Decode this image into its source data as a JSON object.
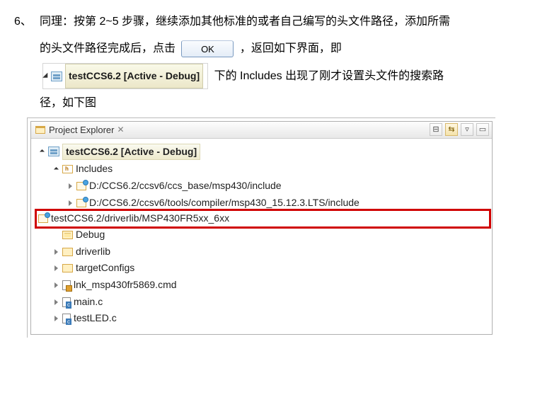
{
  "step": {
    "number": "6、",
    "line1_a": "同理：按第 2~5 步骤，继续添加其他标准的或者自己编写的头文件路径，添加所需",
    "line1_b": "的头文件路径完成后，点击",
    "ok_label": "OK",
    "line1_c": "，返回如下界面，即",
    "badge_project": "testCCS6.2  [Active - Debug]",
    "line2": "下的 Includes 出现了刚才设置头文件的搜索路",
    "line3": "径，如下图"
  },
  "explorer": {
    "title": "Project Explorer",
    "close_glyph": "✕",
    "project": "testCCS6.2  [Active - Debug]",
    "includes_label": "Includes",
    "include_paths": [
      "D:/CCS6.2/ccsv6/ccs_base/msp430/include",
      "D:/CCS6.2/ccsv6/tools/compiler/msp430_15.12.3.LTS/include",
      "testCCS6.2/driverlib/MSP430FR5xx_6xx"
    ],
    "folders": [
      "Debug",
      "driverlib",
      "targetConfigs"
    ],
    "files": [
      "lnk_msp430fr5869.cmd",
      "main.c",
      "testLED.c"
    ]
  }
}
